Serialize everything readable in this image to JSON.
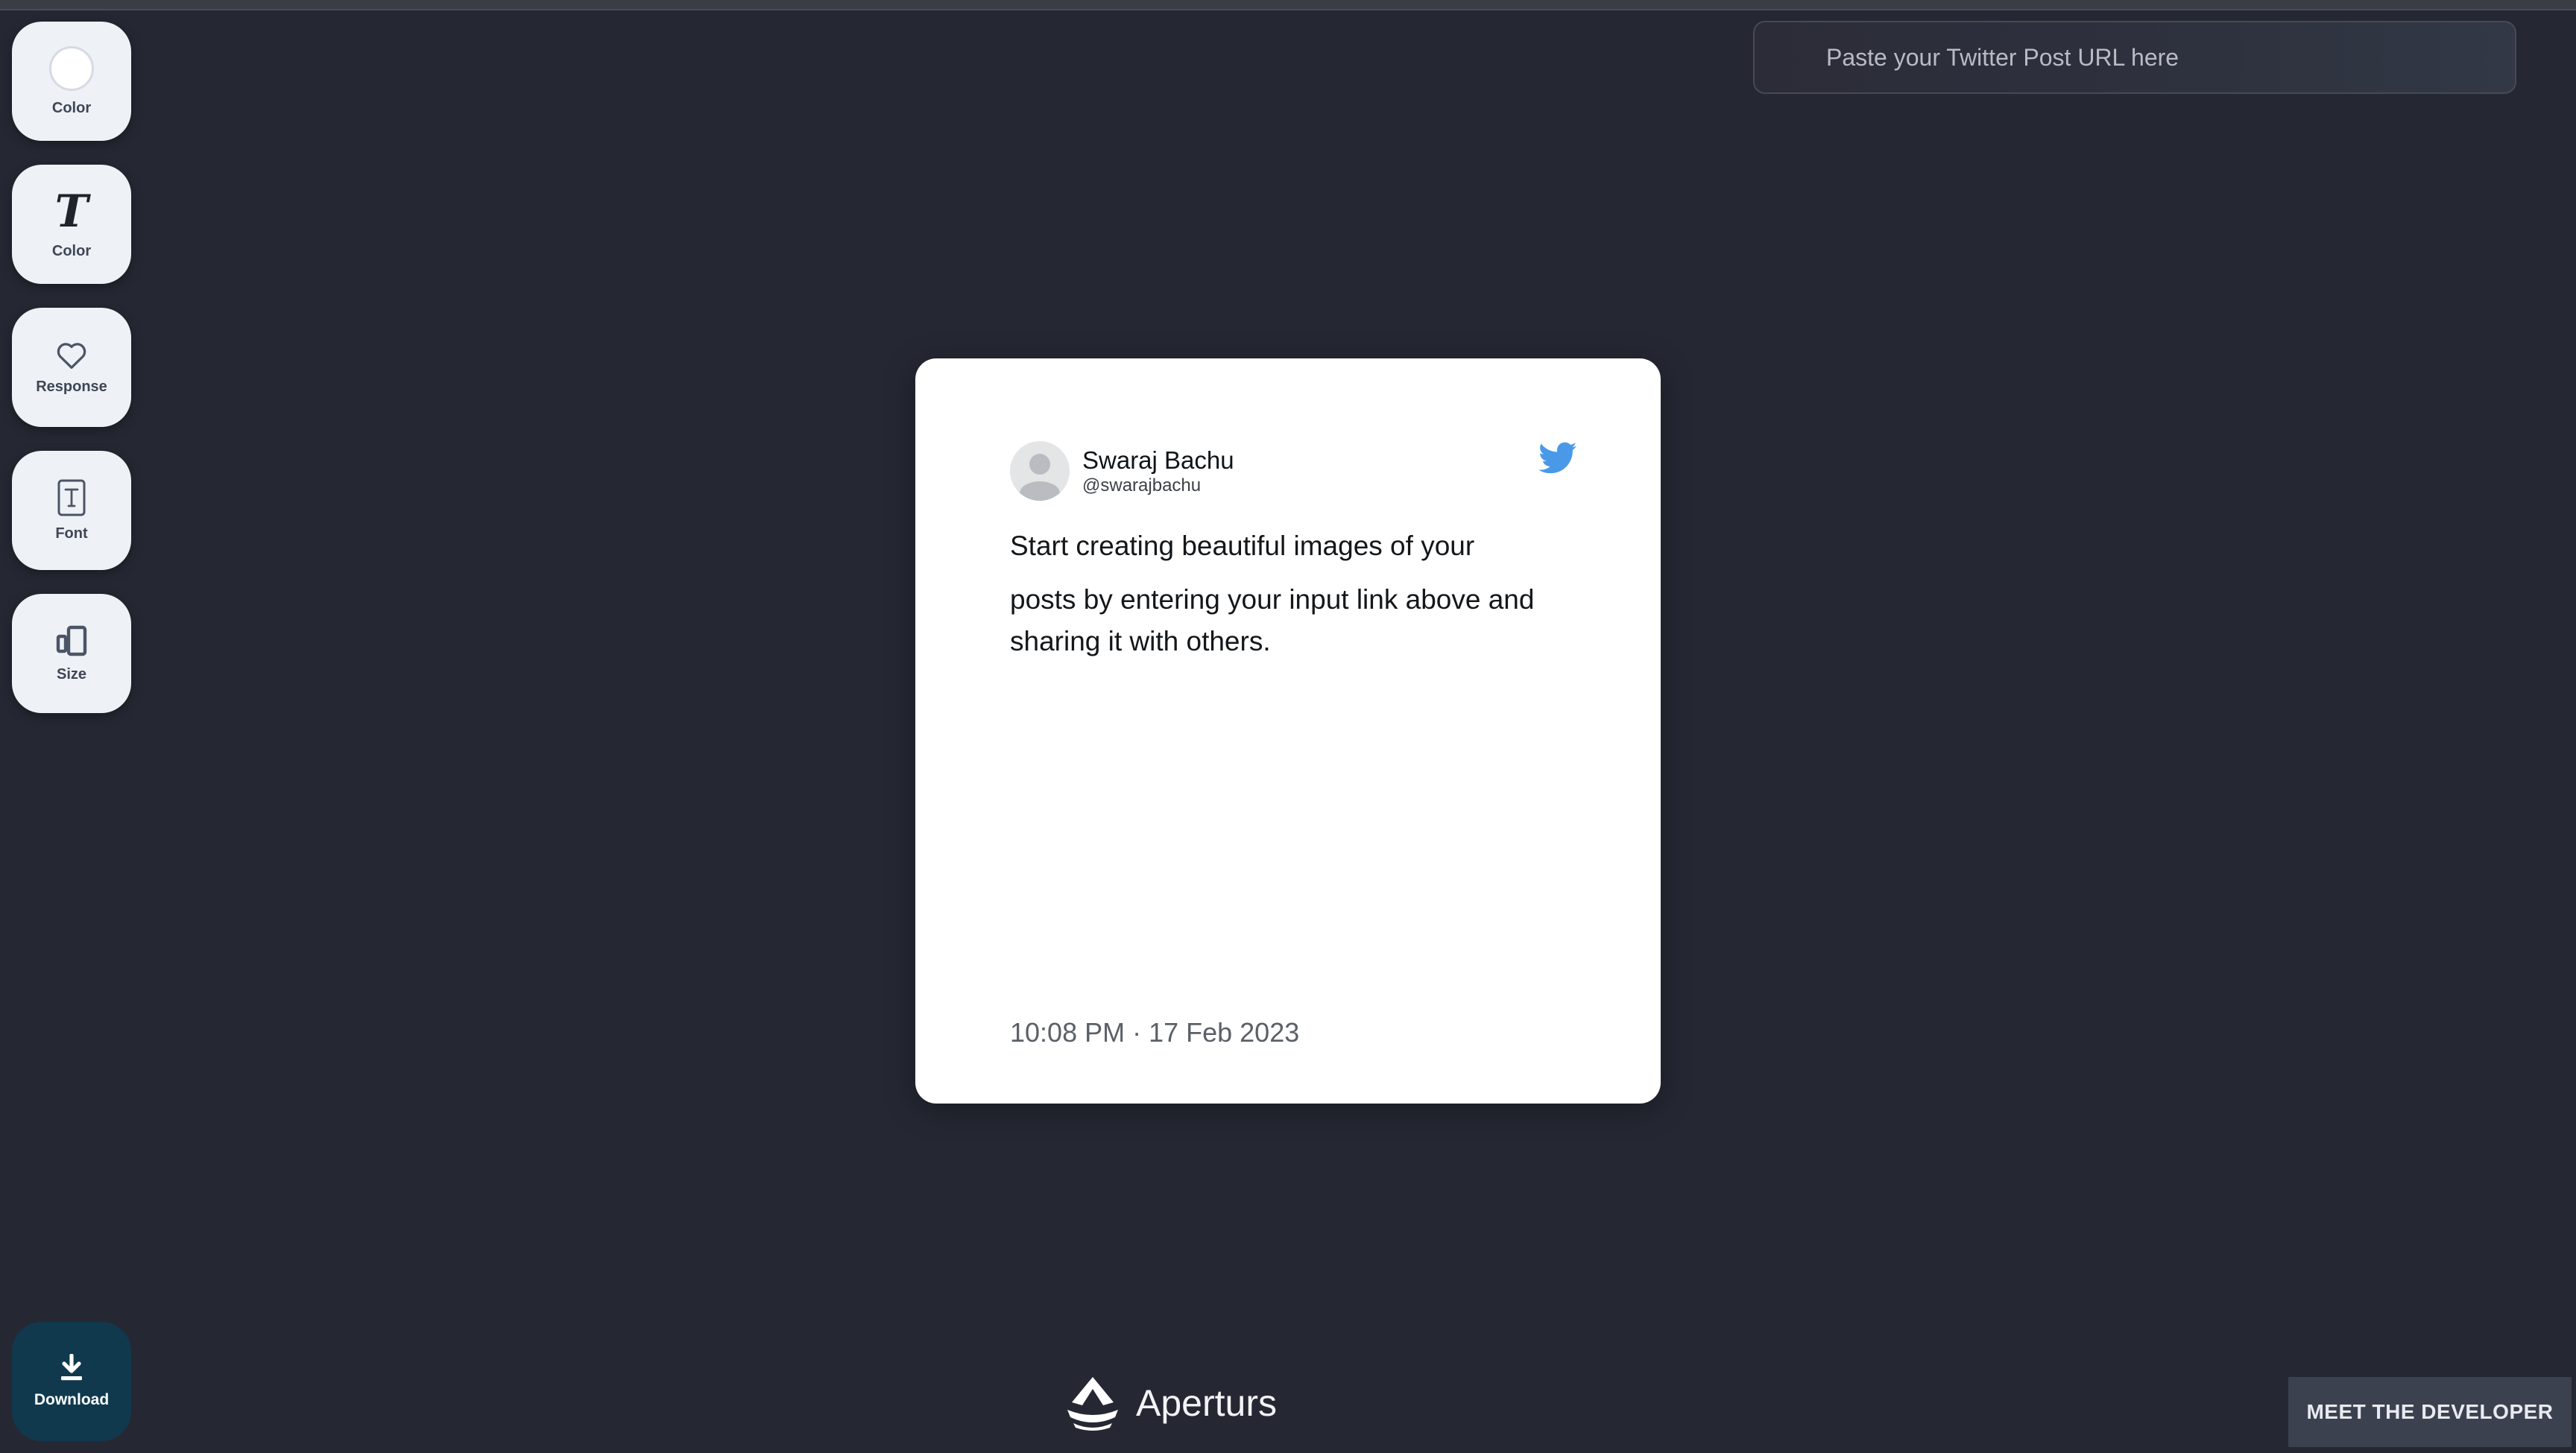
{
  "toolbar": {
    "items": [
      {
        "label": "Color",
        "icon": "color-swatch-icon"
      },
      {
        "label": "Color",
        "icon": "text-color-icon",
        "glyph": "T"
      },
      {
        "label": "Response",
        "icon": "heart-icon"
      },
      {
        "label": "Font",
        "icon": "font-box-icon"
      },
      {
        "label": "Size",
        "icon": "resize-icon"
      }
    ],
    "download_label": "Download"
  },
  "url_input": {
    "placeholder": "Paste your Twitter Post URL here",
    "value": ""
  },
  "tweet": {
    "display_name": "Swaraj Bachu",
    "handle": "@swarajbachu",
    "text_lines": [
      "Start creating beautiful images of your",
      "posts by entering your input link above and",
      "sharing it with others."
    ],
    "timestamp": "10:08 PM · 17 Feb 2023"
  },
  "footer": {
    "brand": "Aperturs",
    "meet_button": "MEET THE DEVELOPER"
  },
  "colors": {
    "background": "#252833",
    "card": "#ffffff",
    "twitter_blue": "#4a99e9",
    "download_bg": "#10394e",
    "tool_bg": "#eef1f6"
  }
}
